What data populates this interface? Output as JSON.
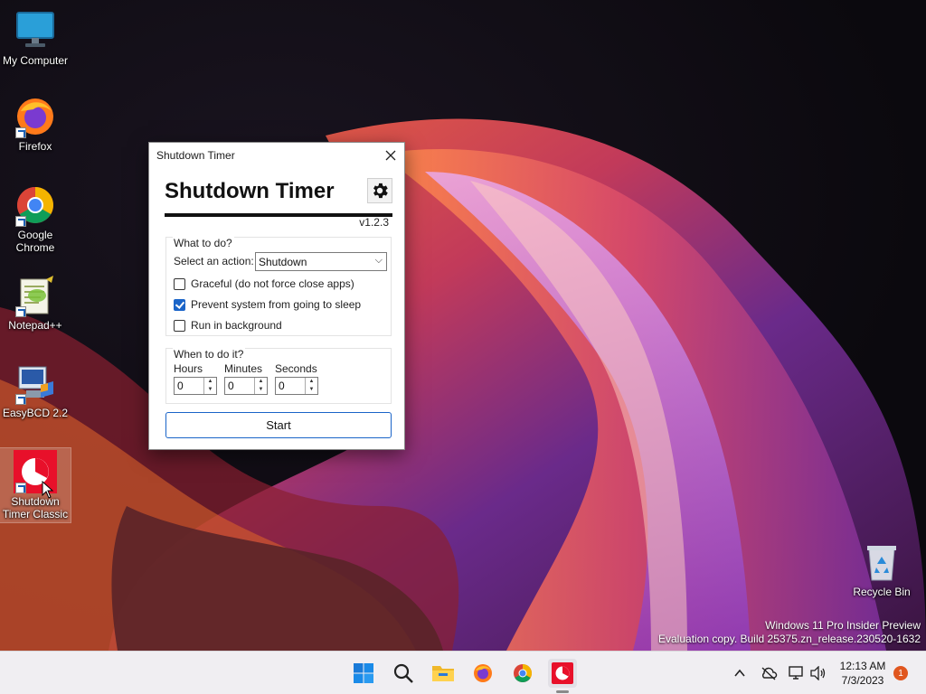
{
  "desktop": {
    "icons": [
      {
        "label": "My Computer"
      },
      {
        "label": "Firefox"
      },
      {
        "label": "Google Chrome"
      },
      {
        "label": "Notepad++"
      },
      {
        "label": "EasyBCD 2.2"
      },
      {
        "label": "Shutdown Timer Classic"
      },
      {
        "label": "Recycle Bin"
      }
    ]
  },
  "dialog": {
    "window_title": "Shutdown Timer",
    "app_title": "Shutdown Timer",
    "version": "v1.2.3",
    "what_group": {
      "legend": "What to do?",
      "action_label": "Select an action:",
      "action_value": "Shutdown",
      "graceful_label": "Graceful (do not force close apps)",
      "graceful_checked": false,
      "prevent_sleep_label": "Prevent system from going to sleep",
      "prevent_sleep_checked": true,
      "background_label": "Run in background",
      "background_checked": false
    },
    "when_group": {
      "legend": "When to do it?",
      "hours_label": "Hours",
      "hours_value": "0",
      "minutes_label": "Minutes",
      "minutes_value": "0",
      "seconds_label": "Seconds",
      "seconds_value": "0"
    },
    "start_label": "Start"
  },
  "watermark": {
    "line1": "Windows 11 Pro Insider Preview",
    "line2": "Evaluation copy. Build 25375.zn_release.230520-1632"
  },
  "taskbar": {
    "apps": [
      "start-icon",
      "search-icon",
      "file-explorer-icon",
      "firefox-icon",
      "chrome-icon",
      "shutdown-timer-icon"
    ],
    "clock_time": "12:13 AM",
    "clock_date": "7/3/2023",
    "notification_count": "1"
  },
  "colors": {
    "accent": "#1a64c8",
    "taskbar_bg": "#f0eef2",
    "notification": "#e0561f"
  }
}
